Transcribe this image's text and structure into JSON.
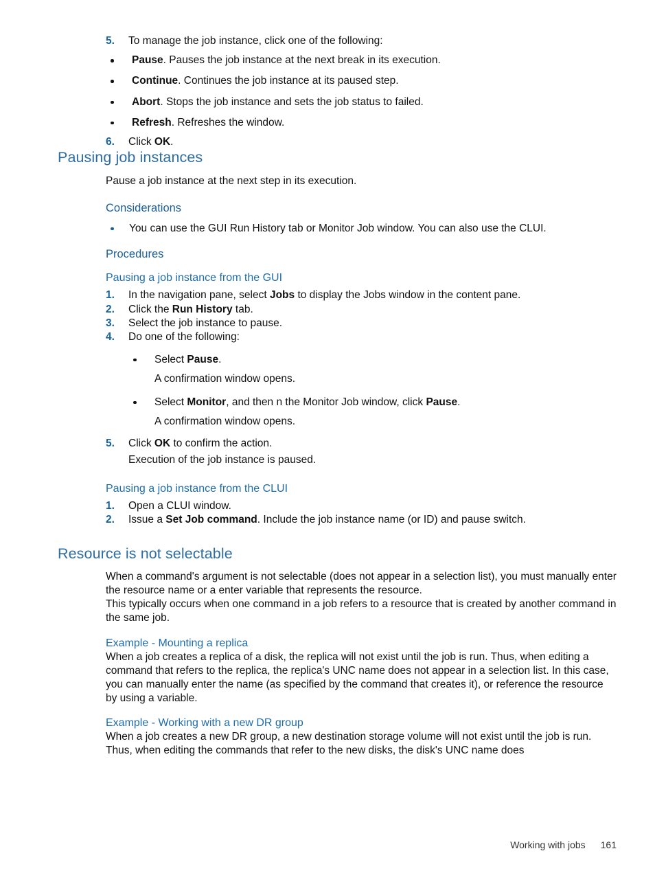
{
  "page": {
    "footer_section": "Working with jobs",
    "footer_page_number": "161",
    "heading_color": "#2e6da4",
    "subheading_color": "#1b6099",
    "list_marker_color": "#18639e",
    "body_color": "#111111"
  },
  "top_steps": {
    "step5": {
      "num": "5.",
      "text": "To manage the job instance, click one of the following:",
      "bullets": [
        {
          "bold": "Pause",
          "rest": ". Pauses the job instance at the next break in its execution."
        },
        {
          "bold": "Continue",
          "rest": ". Continues the job instance at its paused step."
        },
        {
          "bold": "Abort",
          "rest": ". Stops the job instance and sets the job status to failed."
        },
        {
          "bold": "Refresh",
          "rest": ". Refreshes the window."
        }
      ]
    },
    "step6": {
      "num": "6.",
      "pre": "Click ",
      "bold": "OK",
      "post": "."
    }
  },
  "pausing_section": {
    "title": "Pausing job instances",
    "intro": "Pause a job instance at the next step in its execution.",
    "considerations_title": "Considerations",
    "considerations_bullets": [
      "You can use the GUI Run History tab or Monitor Job window. You can also use the CLUI."
    ],
    "procedures_title": "Procedures",
    "gui": {
      "title": "Pausing a job instance from the GUI",
      "steps": [
        {
          "num": "1.",
          "pre": "In the navigation pane, select ",
          "bold": "Jobs",
          "post": " to display the Jobs window in the content pane."
        },
        {
          "num": "2.",
          "pre": "Click the ",
          "bold": "Run History",
          "post": " tab."
        },
        {
          "num": "3.",
          "pre": "Select the job instance to pause.",
          "bold": "",
          "post": ""
        },
        {
          "num": "4.",
          "pre": "Do one of the following:",
          "bold": "",
          "post": ""
        }
      ],
      "step4_bullets": [
        {
          "pre": "Select ",
          "bold": "Pause",
          "post": ".",
          "note": "A confirmation window opens."
        },
        {
          "pre": "Select ",
          "bold": "Monitor",
          "post": ", and then n the Monitor Job window, click ",
          "bold2": "Pause",
          "post2": ".",
          "note": "A confirmation window opens."
        }
      ],
      "step5": {
        "num": "5.",
        "pre": "Click ",
        "bold": "OK",
        "post": " to confirm the action.",
        "note": "Execution of the job instance is paused."
      }
    },
    "clui": {
      "title": "Pausing a job instance from the CLUI",
      "steps": [
        {
          "num": "1.",
          "pre": "Open a CLUI window.",
          "bold": "",
          "post": ""
        },
        {
          "num": "2.",
          "pre": "Issue a ",
          "bold": "Set Job command",
          "post": ". Include the job instance name (or ID) and pause switch."
        }
      ]
    }
  },
  "resource_section": {
    "title": "Resource is not selectable",
    "paragraphs": [
      "When a command's argument is not selectable (does not appear in a selection list), you must manually enter the resource name or a enter variable that represents the resource.",
      "This typically occurs when one command in a job refers to a resource that is created by another command in the same job."
    ],
    "example_replica": {
      "title": "Example - Mounting a replica",
      "body": "When a job creates a replica of a disk, the replica will not exist until the job is run. Thus, when editing a command that refers to the replica, the replica's UNC name does not appear in a selection list. In this case, you can manually enter the name (as specified by the command that creates it), or reference the resource by using a variable."
    },
    "example_dr": {
      "title": "Example - Working with a new DR group",
      "body": "When a job creates a new DR group, a new destination storage volume will not exist until the job is run. Thus, when editing the commands that refer to the new disks, the disk's UNC name does"
    }
  }
}
